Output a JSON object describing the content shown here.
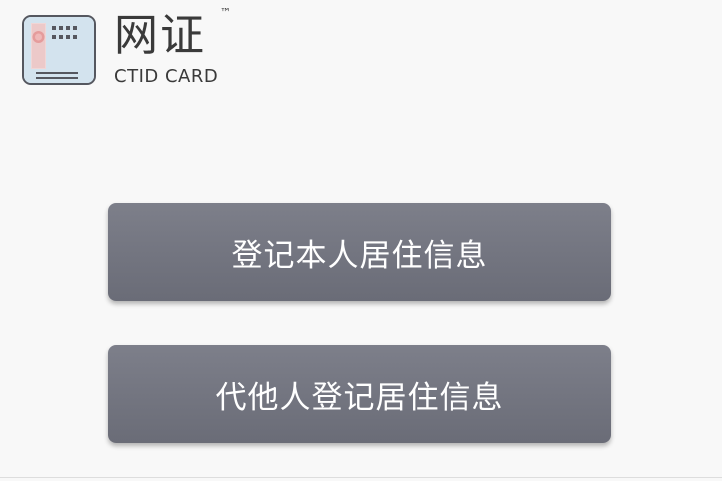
{
  "logo": {
    "title": "网证",
    "trademark": "™",
    "subtitle": "CTID CARD"
  },
  "actions": {
    "register_self": "登记本人居住信息",
    "register_other": "代他人登记居住信息"
  },
  "colors": {
    "button_bg": "#737580",
    "button_text": "#ffffff",
    "page_bg": "#f8f8f8",
    "logo_card_bg": "#cfe1ed",
    "logo_seal": "#e8a9a9"
  }
}
